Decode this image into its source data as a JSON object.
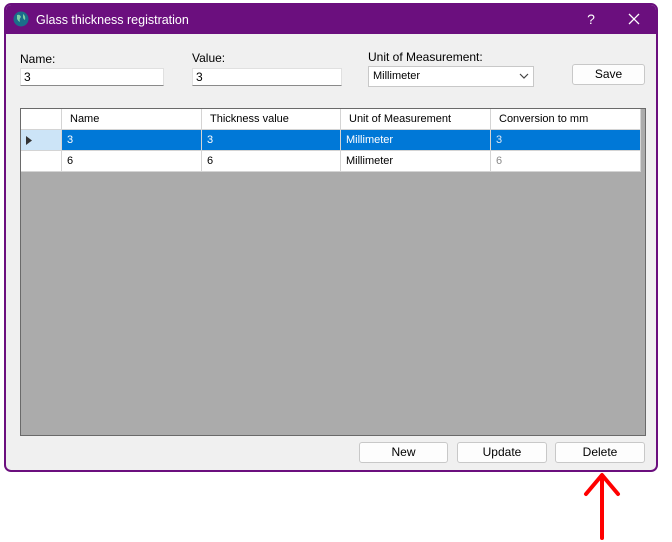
{
  "window": {
    "title": "Glass thickness registration",
    "help_label": "?",
    "accent_color": "#6b0f7e"
  },
  "form": {
    "name_label": "Name:",
    "name_value": "3",
    "value_label": "Value:",
    "value_value": "3",
    "unit_label": "Unit of Measurement:",
    "unit_selected": "Millimeter",
    "save_label": "Save"
  },
  "grid": {
    "columns": [
      "Name",
      "Thickness value",
      "Unit of Measurement",
      "Conversion to mm"
    ],
    "rows": [
      {
        "name": "3",
        "thickness": "3",
        "unit": "Millimeter",
        "conversion": "3",
        "selected": true
      },
      {
        "name": "6",
        "thickness": "6",
        "unit": "Millimeter",
        "conversion": "6",
        "selected": false
      }
    ],
    "selection_color": "#0078d7",
    "background_color": "#ababab"
  },
  "actions": {
    "new_label": "New",
    "update_label": "Update",
    "delete_label": "Delete"
  },
  "annotation": {
    "icon": "red-up-arrow",
    "color": "#ff0000"
  }
}
